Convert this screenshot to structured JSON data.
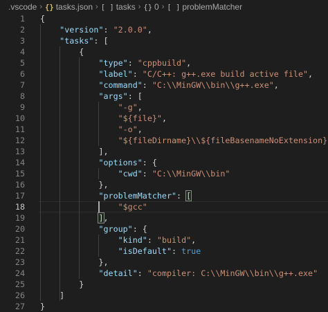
{
  "breadcrumb": [
    {
      "icon": "",
      "icon_name": "",
      "label": ".vscode"
    },
    {
      "icon": "{}",
      "icon_name": "json-file-icon",
      "label": "tasks.json"
    },
    {
      "icon": "[ ]",
      "icon_name": "array-icon",
      "label": "tasks"
    },
    {
      "icon": "{}",
      "icon_name": "object-icon",
      "label": "0"
    },
    {
      "icon": "[ ]",
      "icon_name": "array-icon",
      "label": "problemMatcher"
    }
  ],
  "editor": {
    "current_line": 18,
    "colors": {
      "background": "#1e1e1e",
      "key": "#9cdcfe",
      "string": "#ce9178",
      "punctuation": "#d4d4d4",
      "keyword": "#569cd6",
      "line_number": "#858585"
    },
    "lines": [
      {
        "n": "1",
        "tokens": [
          [
            "p",
            "{"
          ]
        ]
      },
      {
        "n": "2",
        "tokens": [
          [
            "p",
            "    "
          ],
          [
            "k",
            "\"version\""
          ],
          [
            "p",
            ": "
          ],
          [
            "s",
            "\"2.0.0\""
          ],
          [
            "p",
            ","
          ]
        ]
      },
      {
        "n": "3",
        "tokens": [
          [
            "p",
            "    "
          ],
          [
            "k",
            "\"tasks\""
          ],
          [
            "p",
            ": ["
          ]
        ]
      },
      {
        "n": "4",
        "tokens": [
          [
            "p",
            "        {"
          ]
        ]
      },
      {
        "n": "5",
        "tokens": [
          [
            "p",
            "            "
          ],
          [
            "k",
            "\"type\""
          ],
          [
            "p",
            ": "
          ],
          [
            "s",
            "\"cppbuild\""
          ],
          [
            "p",
            ","
          ]
        ]
      },
      {
        "n": "6",
        "tokens": [
          [
            "p",
            "            "
          ],
          [
            "k",
            "\"label\""
          ],
          [
            "p",
            ": "
          ],
          [
            "s",
            "\"C/C++: g++.exe build active file\""
          ],
          [
            "p",
            ","
          ]
        ]
      },
      {
        "n": "7",
        "tokens": [
          [
            "p",
            "            "
          ],
          [
            "k",
            "\"command\""
          ],
          [
            "p",
            ": "
          ],
          [
            "s",
            "\"C:\\\\MinGW\\\\bin\\\\g++.exe\""
          ],
          [
            "p",
            ","
          ]
        ]
      },
      {
        "n": "8",
        "tokens": [
          [
            "p",
            "            "
          ],
          [
            "k",
            "\"args\""
          ],
          [
            "p",
            ": ["
          ]
        ]
      },
      {
        "n": "9",
        "tokens": [
          [
            "p",
            "                "
          ],
          [
            "s",
            "\"-g\""
          ],
          [
            "p",
            ","
          ]
        ]
      },
      {
        "n": "10",
        "tokens": [
          [
            "p",
            "                "
          ],
          [
            "s",
            "\"${file}\""
          ],
          [
            "p",
            ","
          ]
        ]
      },
      {
        "n": "11",
        "tokens": [
          [
            "p",
            "                "
          ],
          [
            "s",
            "\"-o\""
          ],
          [
            "p",
            ","
          ]
        ]
      },
      {
        "n": "12",
        "tokens": [
          [
            "p",
            "                "
          ],
          [
            "s",
            "\"${fileDirname}\\\\${fileBasenameNoExtension}.exe\""
          ]
        ]
      },
      {
        "n": "13",
        "tokens": [
          [
            "p",
            "            ],"
          ]
        ]
      },
      {
        "n": "14",
        "tokens": [
          [
            "p",
            "            "
          ],
          [
            "k",
            "\"options\""
          ],
          [
            "p",
            ": {"
          ]
        ]
      },
      {
        "n": "15",
        "tokens": [
          [
            "p",
            "                "
          ],
          [
            "k",
            "\"cwd\""
          ],
          [
            "p",
            ": "
          ],
          [
            "s",
            "\"C:\\\\MinGW\\\\bin\""
          ]
        ]
      },
      {
        "n": "16",
        "tokens": [
          [
            "p",
            "            },"
          ]
        ]
      },
      {
        "n": "17",
        "tokens": [
          [
            "p",
            "            "
          ],
          [
            "k",
            "\"problemMatcher\""
          ],
          [
            "p",
            ": "
          ],
          [
            "bm",
            "["
          ]
        ]
      },
      {
        "n": "18",
        "tokens": [
          [
            "p",
            "                "
          ],
          [
            "s",
            "\"$gcc\""
          ]
        ]
      },
      {
        "n": "19",
        "tokens": [
          [
            "p",
            "            "
          ],
          [
            "bm",
            "]"
          ],
          [
            "p",
            ","
          ]
        ]
      },
      {
        "n": "20",
        "tokens": [
          [
            "p",
            "            "
          ],
          [
            "k",
            "\"group\""
          ],
          [
            "p",
            ": {"
          ]
        ]
      },
      {
        "n": "21",
        "tokens": [
          [
            "p",
            "                "
          ],
          [
            "k",
            "\"kind\""
          ],
          [
            "p",
            ": "
          ],
          [
            "s",
            "\"build\""
          ],
          [
            "p",
            ","
          ]
        ]
      },
      {
        "n": "22",
        "tokens": [
          [
            "p",
            "                "
          ],
          [
            "k",
            "\"isDefault\""
          ],
          [
            "p",
            ": "
          ],
          [
            "b",
            "true"
          ]
        ]
      },
      {
        "n": "23",
        "tokens": [
          [
            "p",
            "            },"
          ]
        ]
      },
      {
        "n": "24",
        "tokens": [
          [
            "p",
            "            "
          ],
          [
            "k",
            "\"detail\""
          ],
          [
            "p",
            ": "
          ],
          [
            "s",
            "\"compiler: C:\\\\MinGW\\\\bin\\\\g++.exe\""
          ]
        ]
      },
      {
        "n": "25",
        "tokens": [
          [
            "p",
            "        }"
          ]
        ]
      },
      {
        "n": "26",
        "tokens": [
          [
            "p",
            "    ]"
          ]
        ]
      },
      {
        "n": "27",
        "tokens": [
          [
            "p",
            "}"
          ]
        ]
      }
    ]
  }
}
